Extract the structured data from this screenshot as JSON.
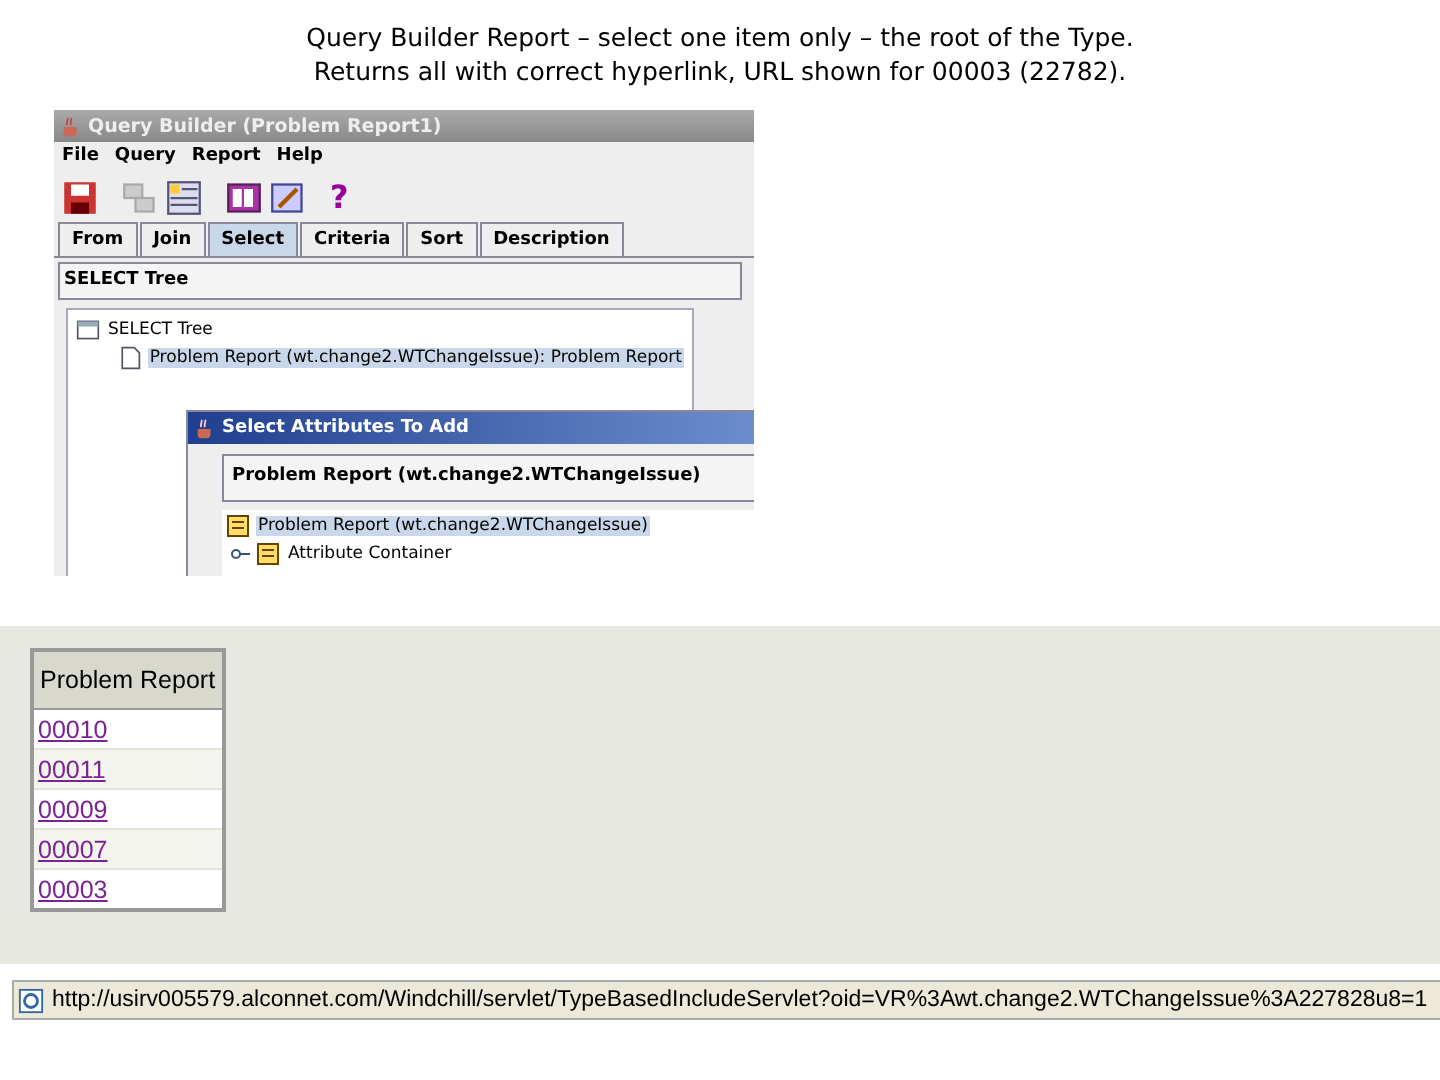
{
  "slide_title": [
    "Query Builder Report – select one item only – the root of the Type.",
    "Returns all with correct hyperlink, URL shown for 00003 (22782)."
  ],
  "query_builder": {
    "title": "Query Builder (Problem Report1)",
    "menu": [
      "File",
      "Query",
      "Report",
      "Help"
    ],
    "help_glyph": "?",
    "tabs": [
      {
        "label": "From",
        "selected": false
      },
      {
        "label": "Join",
        "selected": false
      },
      {
        "label": "Select",
        "selected": true
      },
      {
        "label": "Criteria",
        "selected": false
      },
      {
        "label": "Sort",
        "selected": false
      },
      {
        "label": "Description",
        "selected": false
      }
    ],
    "panel_title": "SELECT Tree",
    "tree": [
      {
        "label": "SELECT Tree",
        "selected": false,
        "children": [
          {
            "label": "Problem Report (wt.change2.WTChangeIssue): Problem Report",
            "selected": true
          }
        ]
      }
    ]
  },
  "dialog": {
    "title": "Select Attributes To Add",
    "type_field": "Problem Report (wt.change2.WTChangeIssue)",
    "tree": [
      {
        "label": "Problem Report (wt.change2.WTChangeIssue)",
        "selected": true,
        "children": [
          {
            "label": "Attribute Container",
            "selected": false,
            "expanded": false
          }
        ]
      }
    ]
  },
  "report_table": {
    "columns": [
      "Problem Report"
    ],
    "rows": [
      "00010",
      "00011",
      "00009",
      "00007",
      "00003"
    ]
  },
  "status_bar": {
    "url": "http://usirv005579.alconnet.com/Windchill/servlet/TypeBasedIncludeServlet?oid=VR%3Awt.change2.WTChangeIssue%3A227828u8=1"
  }
}
